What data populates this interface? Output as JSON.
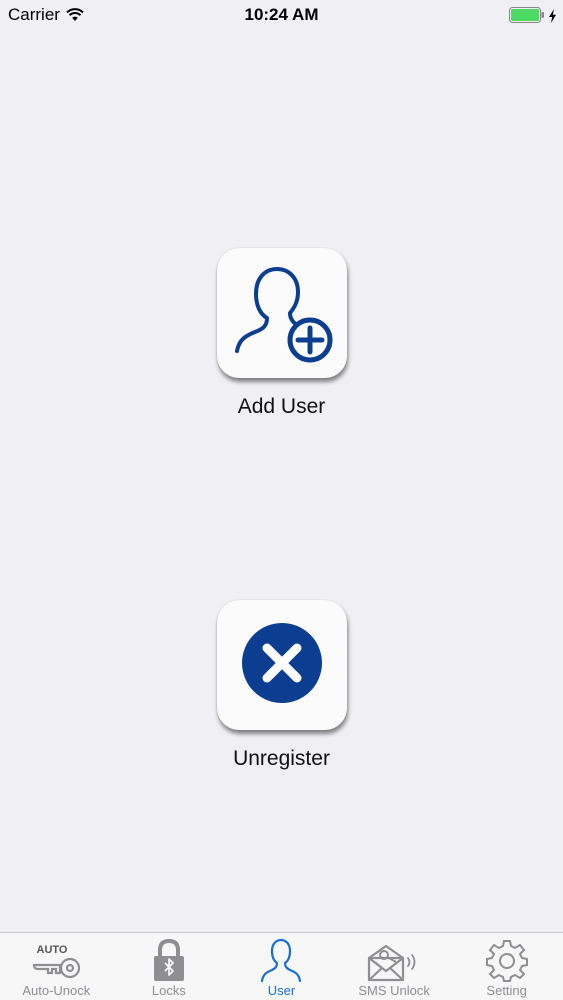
{
  "status_bar": {
    "carrier": "Carrier",
    "time": "10:24 AM",
    "battery_color": "#4cd964"
  },
  "actions": [
    {
      "label": "Add User",
      "icon": "add-user-icon"
    },
    {
      "label": "Unregister",
      "icon": "close-circle-icon"
    }
  ],
  "tab_bar": {
    "items": [
      {
        "label": "Auto-Unock",
        "icon": "auto-key-icon",
        "badge": "AUTO",
        "active": false
      },
      {
        "label": "Locks",
        "icon": "bluetooth-lock-icon",
        "active": false
      },
      {
        "label": "User",
        "icon": "user-icon",
        "active": true
      },
      {
        "label": "SMS Unlock",
        "icon": "sms-envelope-icon",
        "active": false
      },
      {
        "label": "Setting",
        "icon": "gear-icon",
        "active": false
      }
    ]
  },
  "colors": {
    "accent": "#1b6fd0",
    "icon_navy": "#0b3d91",
    "background": "#efeff4",
    "tab_inactive": "#8e8e93"
  }
}
